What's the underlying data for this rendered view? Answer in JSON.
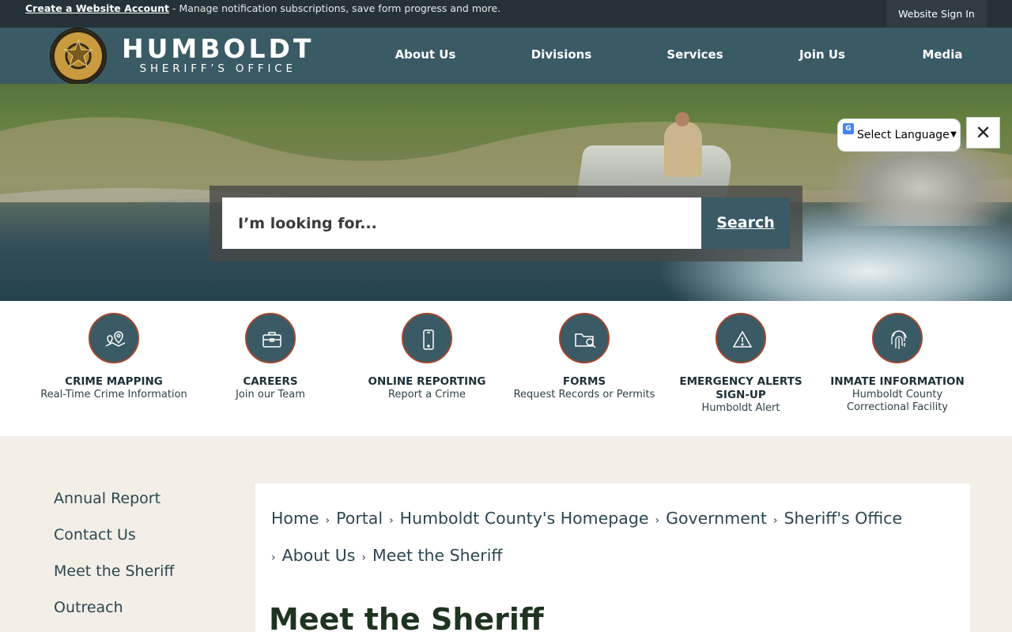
{
  "topbar": {
    "create_account": "Create a Website Account",
    "create_account_desc": " - Manage notification subscriptions, save form progress and more.",
    "sign_in": "Website Sign In"
  },
  "header": {
    "logo_line1": "HUMBOLDT",
    "logo_line2": "SHERIFF’S OFFICE",
    "nav": [
      "About Us",
      "Divisions",
      "Services",
      "Join Us",
      "Media"
    ]
  },
  "search": {
    "placeholder": "I’m looking for...",
    "button": "Search"
  },
  "translate": {
    "label": "Select Language",
    "close": "✕"
  },
  "quick_links": [
    {
      "title": "CRIME MAPPING",
      "subtitle": "Real-Time Crime Information",
      "icon": "map-pin-icon"
    },
    {
      "title": "CAREERS",
      "subtitle": "Join our Team",
      "icon": "briefcase-icon"
    },
    {
      "title": "ONLINE REPORTING",
      "subtitle": "Report a Crime",
      "icon": "phone-icon"
    },
    {
      "title": "FORMS",
      "subtitle": "Request Records or Permits",
      "icon": "folder-search-icon"
    },
    {
      "title": "EMERGENCY ALERTS SIGN-UP",
      "subtitle": "Humboldt Alert",
      "icon": "alert-icon"
    },
    {
      "title": "INMATE INFORMATION",
      "subtitle": "Humboldt County Correctional Facility",
      "icon": "fingerprint-icon"
    }
  ],
  "sidenav": [
    "Annual Report",
    "Contact Us",
    "Meet the Sheriff",
    "Outreach"
  ],
  "breadcrumb": [
    "Home",
    "Portal",
    "Humboldt County's Homepage",
    "Government",
    "Sheriff's Office",
    "About Us",
    "Meet the Sheriff"
  ],
  "page_title": "Meet the Sheriff",
  "colors": {
    "header": "#3a5a66",
    "topbar": "#253238",
    "accent": "#a0472e",
    "background": "#f3efe7"
  }
}
